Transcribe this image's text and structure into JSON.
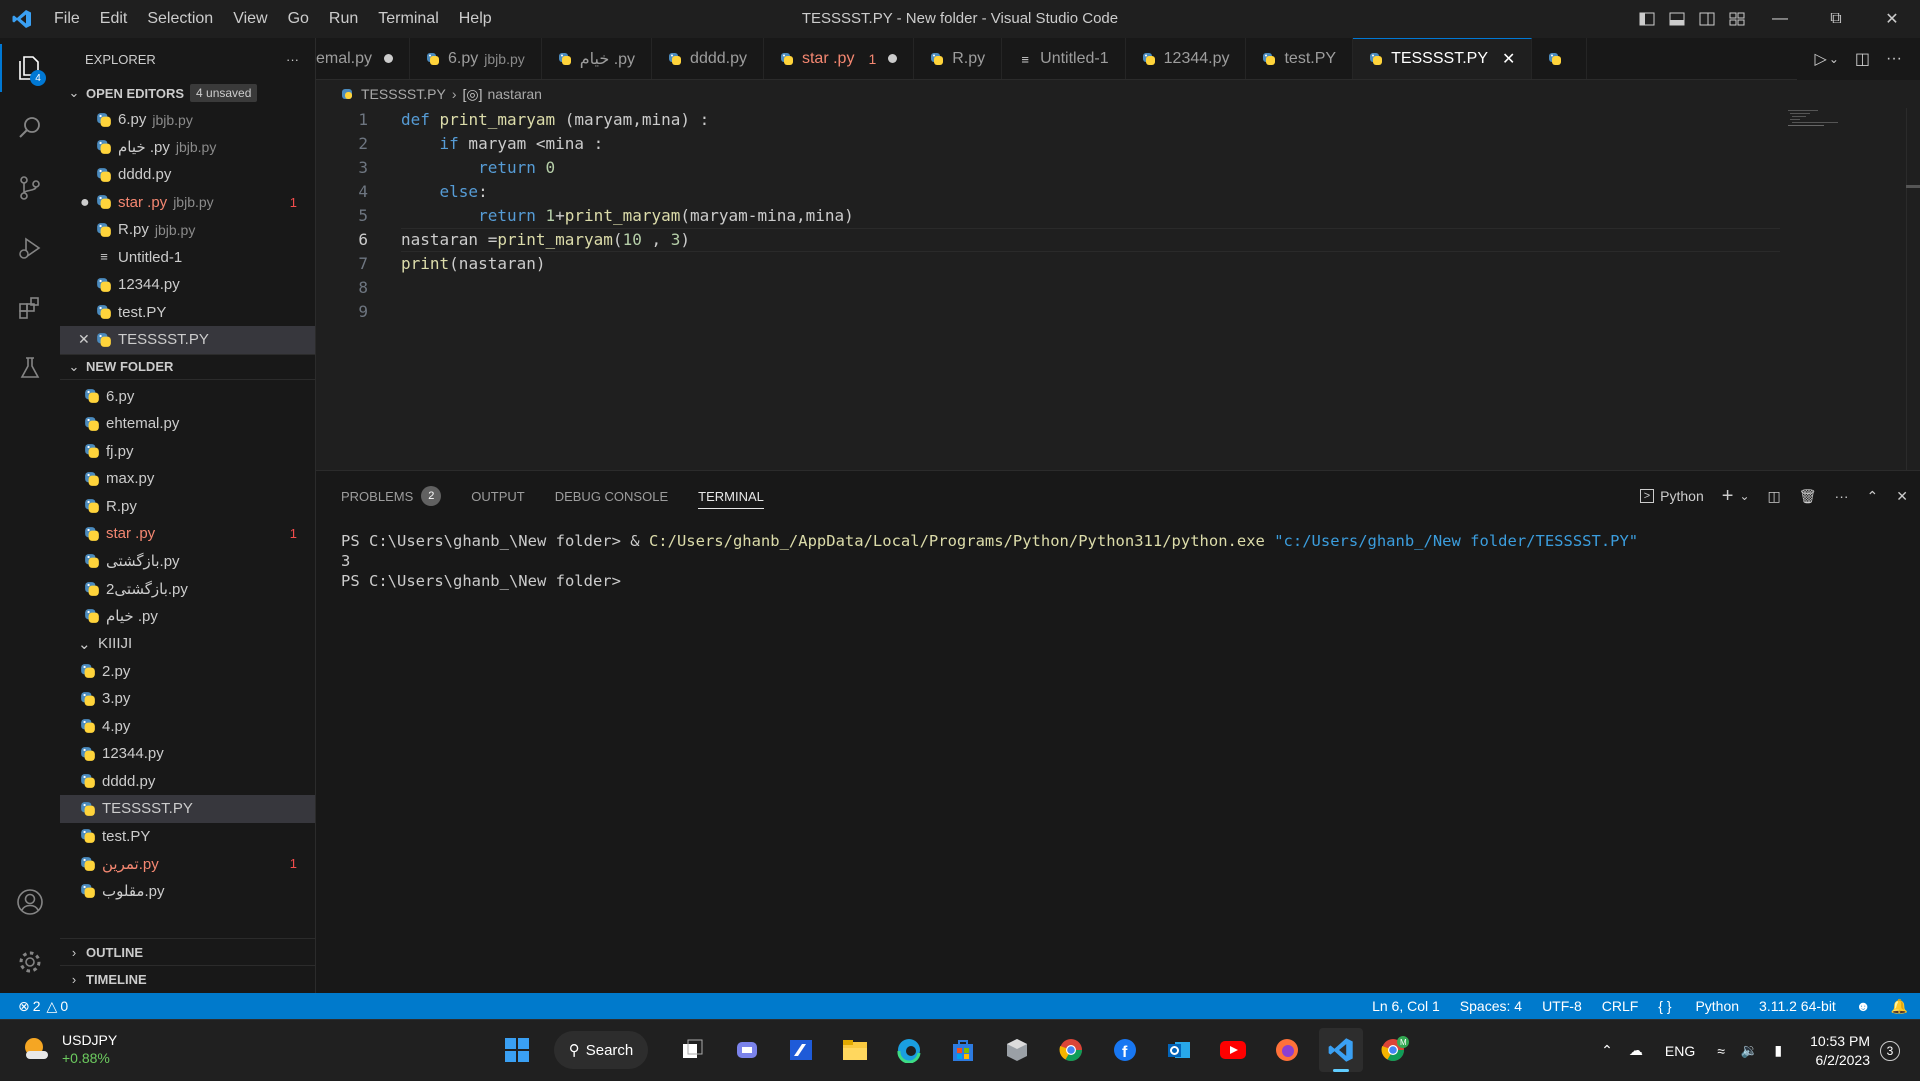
{
  "window": {
    "title": "TESSSST.PY - New folder - Visual Studio Code",
    "menu": [
      "File",
      "Edit",
      "Selection",
      "View",
      "Go",
      "Run",
      "Terminal",
      "Help"
    ]
  },
  "activity_bar": {
    "explorer_badge": "4"
  },
  "sidebar": {
    "title": "EXPLORER",
    "more": "···",
    "open_editors": {
      "label": "OPEN EDITORS",
      "badge": "4 unsaved",
      "items": [
        {
          "name": "6.py",
          "desc": "jbjb.py",
          "err": ""
        },
        {
          "name": "خیام .py",
          "desc": "jbjb.py",
          "err": ""
        },
        {
          "name": "dddd.py",
          "desc": "",
          "err": ""
        },
        {
          "name": "star .py",
          "desc": "jbjb.py",
          "err": "1"
        },
        {
          "name": "R.py",
          "desc": "jbjb.py",
          "err": ""
        },
        {
          "name": "Untitled-1",
          "desc": "",
          "err": ""
        },
        {
          "name": "12344.py",
          "desc": "",
          "err": ""
        },
        {
          "name": "test.PY",
          "desc": "",
          "err": ""
        },
        {
          "name": "TESSSST.PY",
          "desc": "",
          "err": ""
        }
      ]
    },
    "folder": {
      "label": "NEW FOLDER",
      "items": [
        {
          "name": "6.py",
          "err": ""
        },
        {
          "name": "ehtemal.py",
          "err": ""
        },
        {
          "name": "fj.py",
          "err": ""
        },
        {
          "name": "max.py",
          "err": ""
        },
        {
          "name": "R.py",
          "err": ""
        },
        {
          "name": "star .py",
          "err": "1"
        },
        {
          "name": "بازگشتی.py",
          "err": ""
        },
        {
          "name": "بازگشتی2.py",
          "err": ""
        },
        {
          "name": "خیام .py",
          "err": ""
        }
      ],
      "subfolder": "KIIIJI",
      "sub_items": [
        {
          "name": "2.py",
          "err": ""
        },
        {
          "name": "3.py",
          "err": ""
        },
        {
          "name": "4.py",
          "err": ""
        },
        {
          "name": "12344.py",
          "err": ""
        },
        {
          "name": "dddd.py",
          "err": ""
        },
        {
          "name": "TESSSST.PY",
          "err": ""
        },
        {
          "name": "test.PY",
          "err": ""
        },
        {
          "name": "تمرین.py",
          "err": "1"
        },
        {
          "name": "مقلوب.py",
          "err": ""
        }
      ]
    },
    "outline": "OUTLINE",
    "timeline": "TIMELINE"
  },
  "tabs": [
    {
      "label": "emal.py",
      "desc": "",
      "dirty": true,
      "red": false,
      "err": ""
    },
    {
      "label": "6.py",
      "desc": "jbjb.py",
      "dirty": false,
      "red": false,
      "err": ""
    },
    {
      "label": "خیام .py",
      "desc": "",
      "dirty": false,
      "red": false,
      "err": ""
    },
    {
      "label": "dddd.py",
      "desc": "",
      "dirty": false,
      "red": false,
      "err": ""
    },
    {
      "label": "star .py",
      "desc": "",
      "dirty": true,
      "red": true,
      "err": "1"
    },
    {
      "label": "R.py",
      "desc": "",
      "dirty": false,
      "red": false,
      "err": ""
    },
    {
      "label": "Untitled-1",
      "desc": "",
      "dirty": false,
      "red": false,
      "err": ""
    },
    {
      "label": "12344.py",
      "desc": "",
      "dirty": false,
      "red": false,
      "err": ""
    },
    {
      "label": "test.PY",
      "desc": "",
      "dirty": false,
      "red": false,
      "err": ""
    },
    {
      "label": "TESSSST.PY",
      "desc": "",
      "dirty": false,
      "red": false,
      "err": "",
      "active": true
    }
  ],
  "breadcrumb": {
    "file": "TESSSST.PY",
    "symbol": "nastaran"
  },
  "editor": {
    "current_line": 6,
    "line_numbers": [
      "1",
      "2",
      "3",
      "4",
      "5",
      "6",
      "7",
      "8",
      "9"
    ]
  },
  "panel": {
    "tabs": [
      "PROBLEMS",
      "OUTPUT",
      "DEBUG CONSOLE",
      "TERMINAL"
    ],
    "problems_count": "2",
    "active_tab": "TERMINAL",
    "shell": "Python",
    "terminal": {
      "line1_prompt": "PS C:\\Users\\ghanb_\\New folder> & ",
      "line1_exe": "C:/Users/ghanb_/AppData/Local/Programs/Python/Python311/python.exe",
      "line1_arg": "\"c:/Users/ghanb_/New folder/TESSSST.PY\"",
      "line2": "3",
      "line3": "PS C:\\Users\\ghanb_\\New folder>"
    }
  },
  "statusbar": {
    "errors": "2",
    "warnings": "0",
    "position": "Ln 6, Col 1",
    "spaces": "Spaces: 4",
    "encoding": "UTF-8",
    "eol": "CRLF",
    "language": "Python",
    "interpreter": "3.11.2 64-bit"
  },
  "taskbar": {
    "ticker": "USDJPY",
    "change": "+0.88%",
    "search": "Search",
    "lang": "ENG",
    "time": "10:53 PM",
    "date": "6/2/2023",
    "notifications": "3"
  },
  "colors": {
    "accent": "#007acc",
    "error": "#f48771",
    "active_tab_border": "#0078d4"
  }
}
